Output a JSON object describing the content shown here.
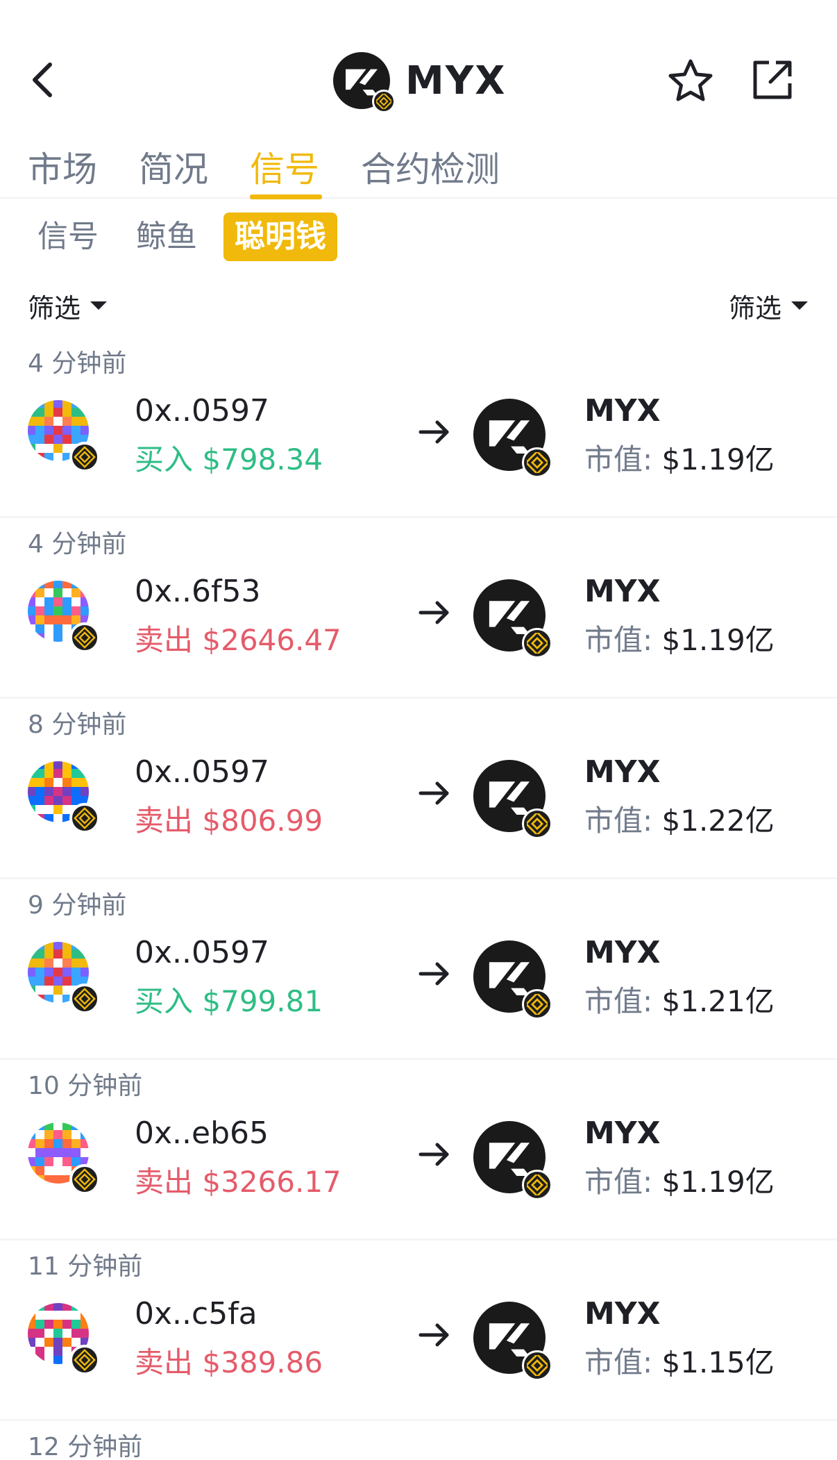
{
  "header": {
    "title": "MYX",
    "icons": {
      "back": "chevron-left-icon",
      "favorite": "star-icon",
      "share": "share-icon"
    }
  },
  "tabs": {
    "main": [
      "市场",
      "简况",
      "信号",
      "合约检测"
    ],
    "active_main": "信号",
    "sub": [
      "信号",
      "鲸鱼",
      "聪明钱"
    ],
    "active_sub": "聪明钱"
  },
  "filters": {
    "left": "筛选",
    "right": "筛选"
  },
  "colors": {
    "accent": "#f0b90b",
    "buy": "#2ebd85",
    "sell": "#e55b6a",
    "muted": "#707a8a",
    "text": "#1e2026"
  },
  "signals": [
    {
      "time": "4 分钟前",
      "wallet": "0x..0597",
      "action": "买入",
      "side": "buy",
      "amount": "$798.34",
      "token": "MYX",
      "mcap_label": "市值:",
      "mcap": "$1.19亿"
    },
    {
      "time": "4 分钟前",
      "wallet": "0x..6f53",
      "action": "卖出",
      "side": "sell",
      "amount": "$2646.47",
      "token": "MYX",
      "mcap_label": "市值:",
      "mcap": "$1.19亿"
    },
    {
      "time": "8 分钟前",
      "wallet": "0x..0597",
      "action": "卖出",
      "side": "sell",
      "amount": "$806.99",
      "token": "MYX",
      "mcap_label": "市值:",
      "mcap": "$1.22亿"
    },
    {
      "time": "9 分钟前",
      "wallet": "0x..0597",
      "action": "买入",
      "side": "buy",
      "amount": "$799.81",
      "token": "MYX",
      "mcap_label": "市值:",
      "mcap": "$1.21亿"
    },
    {
      "time": "10 分钟前",
      "wallet": "0x..eb65",
      "action": "卖出",
      "side": "sell",
      "amount": "$3266.17",
      "token": "MYX",
      "mcap_label": "市值:",
      "mcap": "$1.19亿"
    },
    {
      "time": "11 分钟前",
      "wallet": "0x..c5fa",
      "action": "卖出",
      "side": "sell",
      "amount": "$389.86",
      "token": "MYX",
      "mcap_label": "市值:",
      "mcap": "$1.15亿"
    }
  ],
  "last_time": "12 分钟前"
}
